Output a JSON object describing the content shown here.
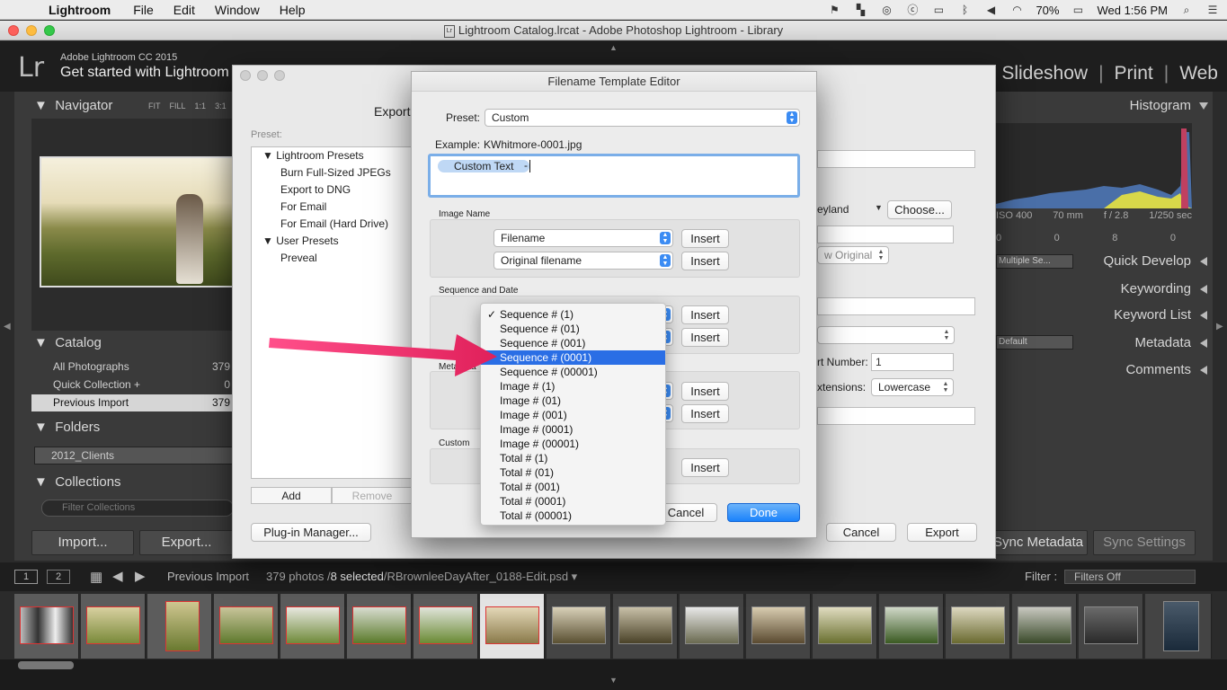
{
  "menubar": {
    "app": "Lightroom",
    "menus": [
      "File",
      "Edit",
      "Window",
      "Help"
    ],
    "battery": "70%",
    "clock": "Wed 1:56 PM"
  },
  "window": {
    "title": "Lightroom Catalog.lrcat - Adobe Photoshop Lightroom - Library",
    "doc_icon": "Lr"
  },
  "lr": {
    "logo": "Lr",
    "version": "Adobe Lightroom CC 2015",
    "get_started": "Get started with Lightroom",
    "modules": [
      "Slideshow",
      "Print",
      "Web"
    ],
    "left": {
      "navigator": "Navigator",
      "nav_zoom": [
        "FIT",
        "FILL",
        "1:1",
        "3:1"
      ],
      "catalog": "Catalog",
      "catalog_rows": [
        {
          "label": "All Photographs",
          "count": "379"
        },
        {
          "label": "Quick Collection +",
          "count": "0"
        },
        {
          "label": "Previous Import",
          "count": "379"
        }
      ],
      "folders": "Folders",
      "folder_item": "2012_Clients",
      "collections": "Collections",
      "filter_collections": "Filter Collections",
      "import_btn": "Import...",
      "export_btn": "Export..."
    },
    "right": {
      "histogram": "Histogram",
      "exif": [
        "ISO 400",
        "70 mm",
        "f / 2.8",
        "1/250 sec"
      ],
      "counts": [
        "0",
        "0",
        "8",
        "0"
      ],
      "quick_develop_select": "Multiple Se...",
      "quick_develop": "Quick Develop",
      "keywording": "Keywording",
      "keyword_list": "Keyword List",
      "metadata_select": "Default",
      "metadata": "Metadata",
      "comments": "Comments",
      "sync_metadata": "Sync Metadata",
      "sync_settings": "Sync Settings"
    },
    "filmstrip": {
      "view1": "1",
      "view2": "2",
      "source": "Previous Import",
      "photo_count": "379 photos /",
      "selected": "8 selected",
      "file": "/RBrownleeDayAfter_0188-Edit.psd",
      "filter_label": "Filter :",
      "filter_value": "Filters Off"
    }
  },
  "export_dialog": {
    "title_partial": "Export",
    "preset_label": "Preset:",
    "preset_tree": [
      {
        "label": "Lightroom Presets",
        "type": "group"
      },
      {
        "label": "Burn Full-Sized JPEGs",
        "type": "item"
      },
      {
        "label": "Export to DNG",
        "type": "item"
      },
      {
        "label": "For Email",
        "type": "item"
      },
      {
        "label": "For Email (Hard Drive)",
        "type": "item"
      },
      {
        "label": "User Presets",
        "type": "group"
      },
      {
        "label": "Preveal",
        "type": "item"
      }
    ],
    "add": "Add",
    "remove": "Remove",
    "plugin_manager": "Plug-in Manager...",
    "cancel": "Cancel",
    "export": "Export",
    "folder_partial": "eyland",
    "choose": "Choose...",
    "original_partial": "w Original",
    "start_number_label": "rt Number:",
    "start_number": "1",
    "extensions_label": "xtensions:",
    "extensions": "Lowercase"
  },
  "fte": {
    "title": "Filename Template Editor",
    "preset_label": "Preset:",
    "preset_value": "Custom",
    "example_label": "Example:",
    "example_value": "KWhitmore-0001.jpg",
    "token": "Custom Text",
    "token_suffix": "-",
    "image_name_label": "Image Name",
    "image_name_selects": [
      "Filename",
      "Original filename"
    ],
    "insert": "Insert",
    "seq_date_label": "Sequence and Date",
    "metadata_label": "Metadata",
    "custom_label": "Custom",
    "cancel": "Cancel",
    "done": "Done"
  },
  "dropdown": {
    "items": [
      "Sequence # (1)",
      "Sequence # (01)",
      "Sequence # (001)",
      "Sequence # (0001)",
      "Sequence # (00001)",
      "Image # (1)",
      "Image # (01)",
      "Image # (001)",
      "Image # (0001)",
      "Image # (00001)",
      "Total # (1)",
      "Total # (01)",
      "Total # (001)",
      "Total # (0001)",
      "Total # (00001)"
    ],
    "checked_item": "Sequence # (1)",
    "highlighted_item": "Sequence # (0001)"
  },
  "colors": {
    "annotation_arrow": "#f0306a",
    "menu_highlight": "#2a6ee5",
    "primary_button": "#1a82fb"
  }
}
